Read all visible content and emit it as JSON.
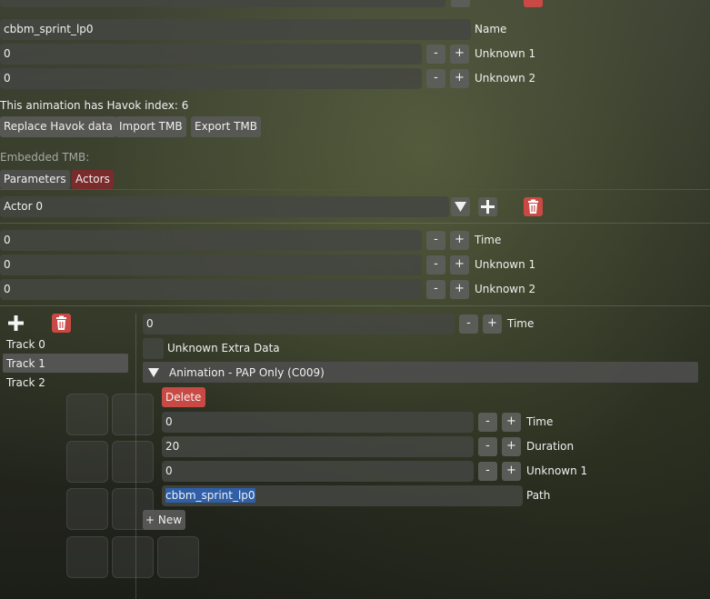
{
  "top": {
    "name_value": "cbbm_sprint_lp0",
    "name_label": "Name",
    "unknown1_value": "0",
    "unknown1_label": "Unknown 1",
    "unknown2_value": "0",
    "unknown2_label": "Unknown 2",
    "minus": "-",
    "plus": "+"
  },
  "havok": {
    "info": "This animation has Havok index: 6",
    "replace": "Replace Havok data",
    "import": "Import TMB",
    "export": "Export TMB"
  },
  "embedded": {
    "label": "Embedded TMB:",
    "tabs": [
      "Parameters",
      "Actors"
    ],
    "active_tab": "Actors"
  },
  "actor": {
    "selected": "Actor 0",
    "time_value": "0",
    "time_label": "Time",
    "unknown1_value": "0",
    "unknown1_label": "Unknown 1",
    "unknown2_value": "0",
    "unknown2_label": "Unknown 2"
  },
  "tracks": {
    "items": [
      "Track 0",
      "Track 1",
      "Track 2"
    ],
    "selected": "Track 1"
  },
  "track_detail": {
    "time_value": "0",
    "time_label": "Time",
    "extra_label": "Unknown Extra Data",
    "header": "Animation - PAP Only (C009)",
    "delete": "Delete",
    "entry": {
      "time_value": "0",
      "time_label": "Time",
      "duration_value": "20",
      "duration_label": "Duration",
      "unknown1_value": "0",
      "unknown1_label": "Unknown 1",
      "path_value": "cbbm_sprint_lp0",
      "path_label": "Path"
    },
    "new_button": "+ New"
  },
  "colors": {
    "accent_red": "#c94a45",
    "active_tab": "#7a2b2b",
    "selection": "#2f5fa8"
  }
}
